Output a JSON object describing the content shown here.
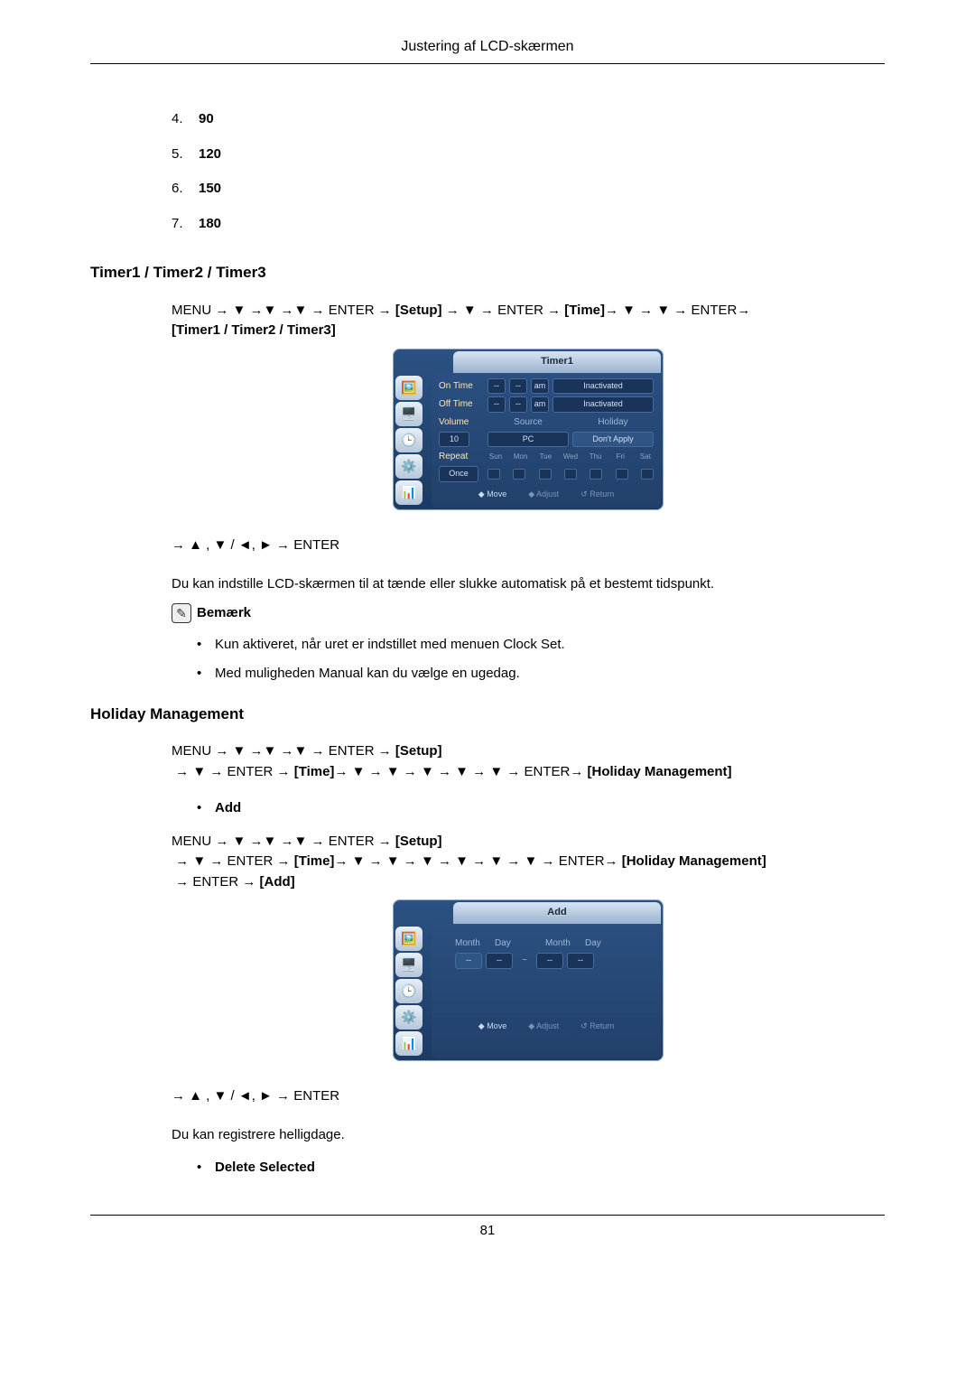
{
  "header": "Justering af LCD-skærmen",
  "pageNum": "81",
  "list": [
    {
      "n": "4.",
      "v": "90"
    },
    {
      "n": "5.",
      "v": "120"
    },
    {
      "n": "6.",
      "v": "150"
    },
    {
      "n": "7.",
      "v": "180"
    }
  ],
  "timer": {
    "title": "Timer1 / Timer2 / Timer3",
    "path_a": "MENU → ▼ →▼ →▼ → ENTER → ",
    "path_setup": "[Setup]",
    "path_b": " → ▼ → ENTER → ",
    "path_time": "[Time]",
    "path_c": "→ ▼ → ▼ → ENTER→ ",
    "path_target": "[Timer1 / Timer2 / Timer3]",
    "navLine": "→ ▲ , ▼ / ◄, ► → ENTER",
    "para": "Du kan indstille LCD-skærmen til at tænde eller slukke automatisk på et bestemt tidspunkt.",
    "noteLabel": "Bemærk",
    "bullets": [
      "Kun aktiveret, når uret er indstillet med menuen Clock Set.",
      "Med muligheden Manual kan du vælge en ugedag."
    ]
  },
  "osd1": {
    "tab": "Timer1",
    "rows": {
      "onTime": "On Time",
      "offTime": "Off Time",
      "volume": "Volume",
      "source": "Source",
      "holiday": "Holiday",
      "repeat": "Repeat",
      "dashChip": "--",
      "am": "am",
      "inactivated": "Inactivated",
      "volVal": "10",
      "srcVal": "PC",
      "holVal": "Don't Apply",
      "repVal": "Once"
    },
    "days": [
      "Sun",
      "Mon",
      "Tue",
      "Wed",
      "Thu",
      "Fri",
      "Sat"
    ],
    "footer": {
      "move": "◆ Move",
      "adjust": "◆ Adjust",
      "ret": "↺ Return"
    }
  },
  "holiday": {
    "title": "Holiday Management",
    "path_a": "MENU → ▼ →▼ →▼ → ENTER → ",
    "path_setup": "[Setup]",
    "path_b": " → ▼ → ENTER → ",
    "path_time": "[Time]",
    "path_c": "→ ▼ → ▼ → ▼ → ▼ → ▼ → ENTER→ ",
    "path_target": "[Holiday Management]",
    "addLabel": "Add",
    "add_path_a": "MENU → ▼ →▼ →▼ → ENTER → ",
    "add_path_b": " → ▼ → ENTER → ",
    "add_path_c": "→ ▼ → ▼ → ▼ → ▼ → ▼ → ▼ → ENTER→ ",
    "add_target": "[Holiday Management]",
    "add_mid": " → ENTER → ",
    "add_end": "[Add]",
    "navLine": "→ ▲ , ▼ / ◄, ► → ENTER",
    "para": "Du kan registrere helligdage.",
    "deleteLabel": "Delete Selected"
  },
  "osd2": {
    "tab": "Add",
    "month": "Month",
    "day": "Day",
    "dash": "--",
    "tilde": "~",
    "footer": {
      "move": "◆ Move",
      "adjust": "◆ Adjust",
      "ret": "↺ Return"
    }
  }
}
